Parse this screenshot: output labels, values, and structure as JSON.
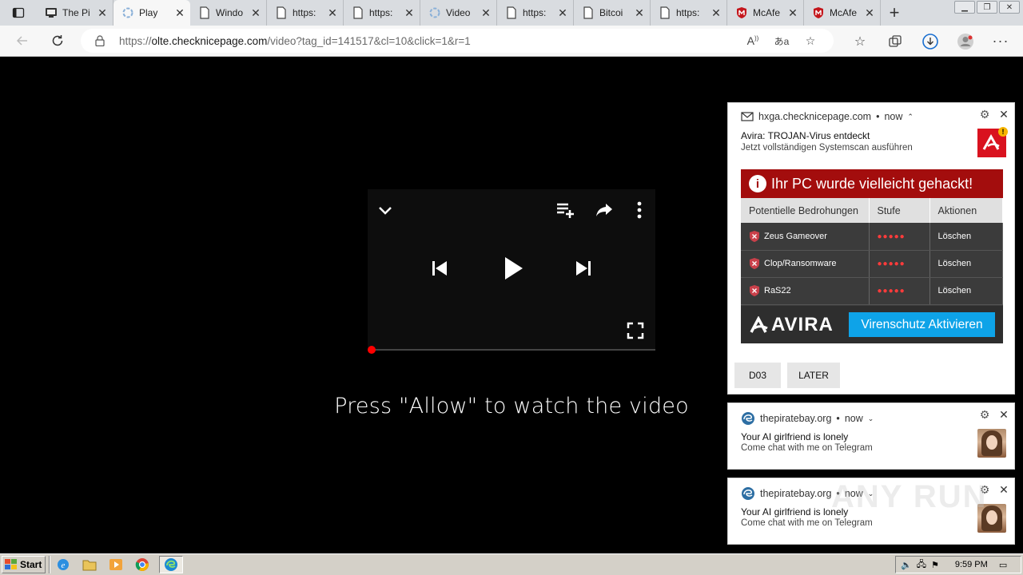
{
  "browser": {
    "tabs": [
      {
        "title": "The Pi",
        "icon": "browser-icon",
        "active": false
      },
      {
        "title": "Play",
        "icon": "loading-icon",
        "active": true
      },
      {
        "title": "Windo",
        "icon": "page-icon",
        "active": false
      },
      {
        "title": "https:",
        "icon": "page-icon",
        "active": false
      },
      {
        "title": "https:",
        "icon": "page-icon",
        "active": false
      },
      {
        "title": "Video",
        "icon": "loading-icon",
        "active": false
      },
      {
        "title": "https:",
        "icon": "page-icon",
        "active": false
      },
      {
        "title": "Bitcoi",
        "icon": "page-icon",
        "active": false
      },
      {
        "title": "https:",
        "icon": "page-icon",
        "active": false
      },
      {
        "title": "McAfe",
        "icon": "mcafee-icon",
        "active": false
      },
      {
        "title": "McAfe",
        "icon": "mcafee-icon",
        "active": false
      }
    ],
    "url_prefix": "https://",
    "url_host": "olte.checknicepage.com",
    "url_path": "/video?tag_id=141517&cl=10&click=1&r=1"
  },
  "page": {
    "allow_text": "Press \"Allow\" to watch the video",
    "progress_fraction": 0.0
  },
  "notifications": [
    {
      "source": "hxga.checknicepage.com",
      "time": "now",
      "title": "Avira: TROJAN-Virus entdeckt",
      "body": "Jetzt vollständigen Systemscan ausführen",
      "ad": {
        "header": "Ihr PC wurde vielleicht gehackt!",
        "columns": [
          "Potentielle Bedrohungen",
          "Stufe",
          "Aktionen"
        ],
        "rows": [
          {
            "threat": "Zeus Gameover",
            "level": "●●●●●",
            "action": "Löschen"
          },
          {
            "threat": "Clop/Ransomware",
            "level": "●●●●●",
            "action": "Löschen"
          },
          {
            "threat": "RaS22",
            "level": "●●●●●",
            "action": "Löschen"
          }
        ],
        "logo": "AVIRA",
        "cta": "Virenschutz Aktivieren"
      },
      "buttons": [
        "D03",
        "LATER"
      ]
    },
    {
      "source": "thepiratebay.org",
      "time": "now",
      "title": "Your AI girlfriend is lonely",
      "body": "Come chat with me on Telegram"
    },
    {
      "source": "thepiratebay.org",
      "time": "now",
      "title": "Your AI girlfriend is lonely",
      "body": "Come chat with me on Telegram"
    }
  ],
  "taskbar": {
    "start_label": "Start",
    "clock": "9:59 PM"
  },
  "watermark": "ANY RUN",
  "colors": {
    "accent_red": "#a30d0d",
    "cta_blue": "#0ea3e8",
    "progress_red": "#ff0000"
  }
}
